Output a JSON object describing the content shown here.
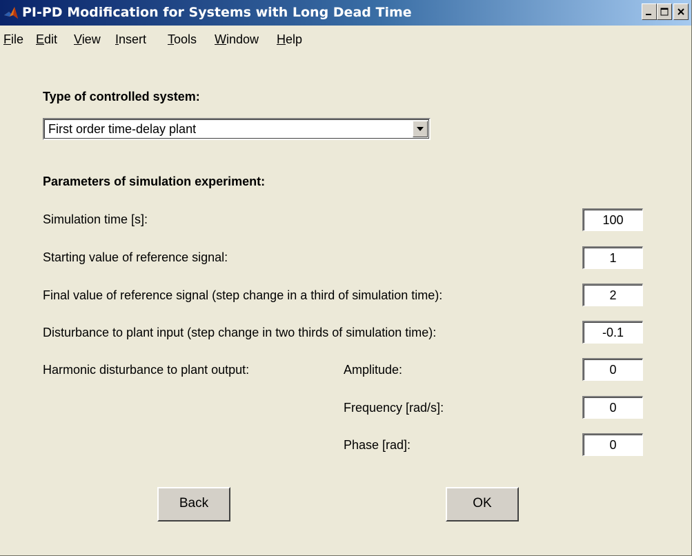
{
  "window": {
    "title": "PI-PD Modification for Systems with Long Dead Time",
    "icon": "matlab-logo-icon"
  },
  "menu": {
    "items": [
      "File",
      "Edit",
      "View",
      "Insert",
      "Tools",
      "Window",
      "Help"
    ]
  },
  "form": {
    "system_type_heading": "Type of controlled system:",
    "system_type_value": "First order time-delay plant",
    "params_heading": "Parameters of simulation experiment:",
    "sim_time_label": "Simulation time [s]:",
    "sim_time_value": "100",
    "ref_start_label": "Starting value of reference signal:",
    "ref_start_value": "1",
    "ref_final_label": "Final value of reference signal (step change in a third of simulation time):",
    "ref_final_value": "2",
    "input_dist_label": "Disturbance to plant input (step change in two thirds of simulation time):",
    "input_dist_value": "-0.1",
    "harmonic_label": "Harmonic disturbance to plant output:",
    "amplitude_label": "Amplitude:",
    "amplitude_value": "0",
    "frequency_label": "Frequency [rad/s]:",
    "frequency_value": "0",
    "phase_label": "Phase [rad]:",
    "phase_value": "0"
  },
  "buttons": {
    "back_label": "Back",
    "ok_label": "OK"
  }
}
